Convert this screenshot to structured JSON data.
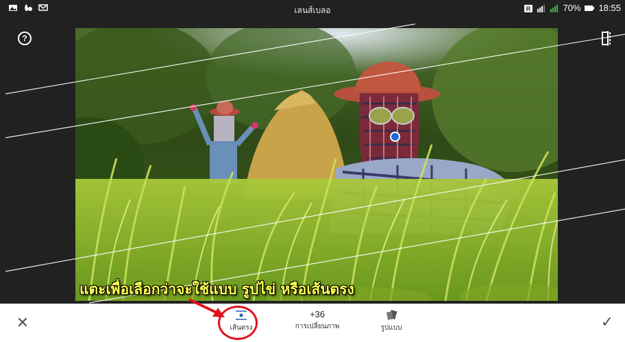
{
  "statusbar": {
    "battery": "70%",
    "time": "18:55",
    "icons": [
      "gallery-icon",
      "drop-icon",
      "mail-icon",
      "sim-icon",
      "signal-icon",
      "signal-icon-2",
      "battery-icon"
    ]
  },
  "header": {
    "mode_label": "เลนส์เบลอ",
    "help_icon": "help-icon",
    "help_symbol": "?",
    "compare_icon": "compare-icon"
  },
  "caption": "แตะเพื่อเลือกว่าจะใช้แบบ รูปไข่ หรือเส้นตรง",
  "toolbar": {
    "cancel_symbol": "✕",
    "apply_symbol": "✓",
    "tools": [
      {
        "label": "เส้นตรง",
        "icon": "linear-blur-icon"
      },
      {
        "value": "+36",
        "label": "การเปลี่ยนภาพ"
      },
      {
        "label": "รูปแบบ",
        "icon": "style-icon"
      }
    ]
  },
  "colors": {
    "highlight": "#e0121d",
    "caption": "#ffff55",
    "handle": "#1e6ad6"
  }
}
